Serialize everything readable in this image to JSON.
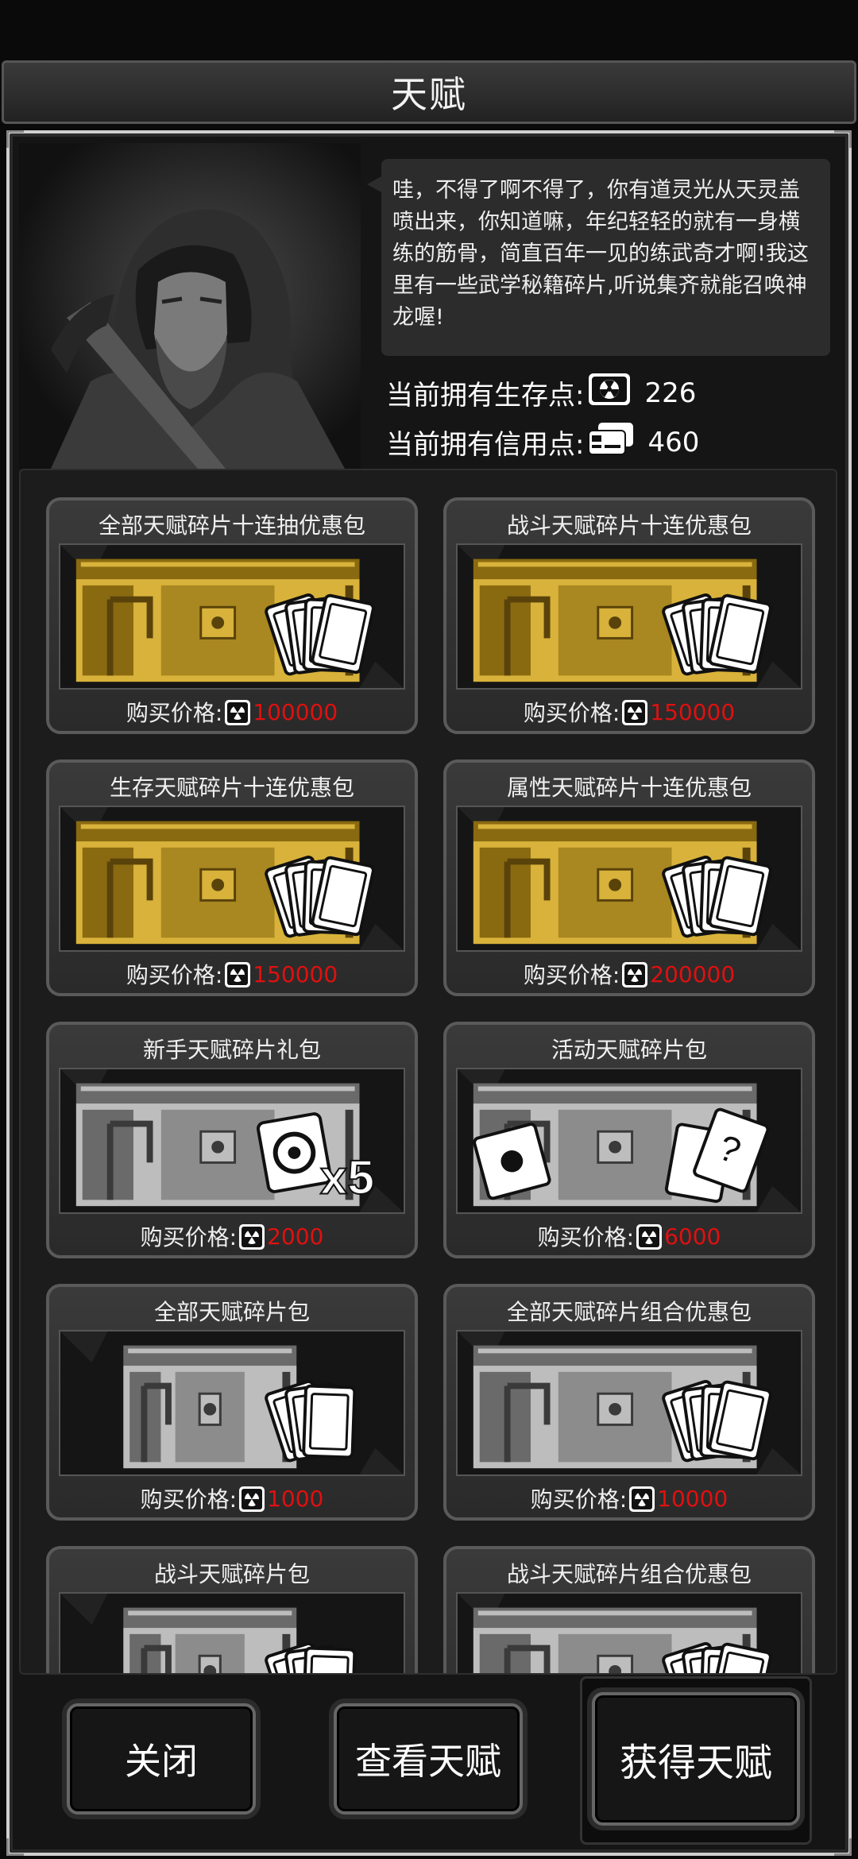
{
  "header": {
    "title": "天赋"
  },
  "npc": {
    "dialog": "哇，不得了啊不得了，你有道灵光从天灵盖喷出来，你知道嘛，年纪轻轻的就有一身横练的筋骨，简直百年一见的练武奇才啊!我这里有一些武学秘籍碎片,听说集齐就能召唤神龙喔!"
  },
  "stats": {
    "survival_label": "当前拥有生存点:",
    "survival_value": "226",
    "survival_icon": "radiation-icon",
    "credit_label": "当前拥有信用点:",
    "credit_value": "460",
    "credit_icon": "credit-card-icon"
  },
  "price_label": "购买价格:",
  "packs": [
    {
      "title": "全部天赋碎片十连抽优惠包",
      "price": "100000",
      "chest": "gold",
      "badge": "cards"
    },
    {
      "title": "战斗天赋碎片十连优惠包",
      "price": "150000",
      "chest": "gold",
      "badge": "cards"
    },
    {
      "title": "生存天赋碎片十连优惠包",
      "price": "150000",
      "chest": "gold",
      "badge": "cards"
    },
    {
      "title": "属性天赋碎片十连优惠包",
      "price": "200000",
      "chest": "gold",
      "badge": "cards"
    },
    {
      "title": "新手天赋碎片礼包",
      "price": "2000",
      "chest": "silver",
      "badge": "x5",
      "badge_text": "x5"
    },
    {
      "title": "活动天赋碎片包",
      "price": "6000",
      "chest": "silver",
      "badge": "puzzles"
    },
    {
      "title": "全部天赋碎片包",
      "price": "1000",
      "chest": "silver-small",
      "badge": "cards3"
    },
    {
      "title": "全部天赋碎片组合优惠包",
      "price": "10000",
      "chest": "silver",
      "badge": "cards"
    },
    {
      "title": "战斗天赋碎片包",
      "price": "",
      "chest": "silver-small",
      "badge": "cards3"
    },
    {
      "title": "战斗天赋碎片组合优惠包",
      "price": "",
      "chest": "silver",
      "badge": "cards"
    }
  ],
  "buttons": {
    "close": "关闭",
    "view": "查看天赋",
    "get": "获得天赋"
  },
  "colors": {
    "price": "#e01010",
    "gold_chest": "#b8901c",
    "silver_chest": "#9a9a9a"
  }
}
